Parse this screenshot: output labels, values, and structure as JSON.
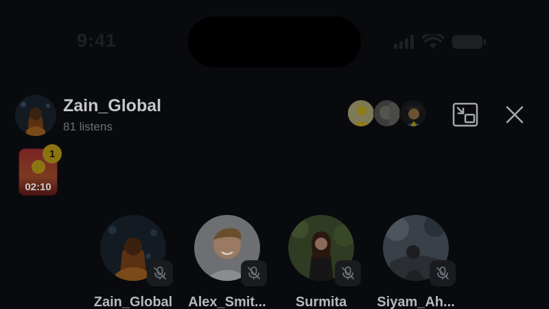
{
  "status_bar": {
    "time": "9:41"
  },
  "room": {
    "host_name": "Zain_Global",
    "listens": "81 listens"
  },
  "gift": {
    "badge_count": "1",
    "timer": "02:10"
  },
  "speakers": [
    {
      "name": "Zain_Global",
      "mic": "mic-off-icon"
    },
    {
      "name": "Alex_Smit...",
      "mic": "mic-off-icon"
    },
    {
      "name": "Surmita",
      "mic": "mic-off-icon"
    },
    {
      "name": "Siyam_Ah...",
      "mic": "mic-off-icon"
    }
  ],
  "colors": {
    "background": "#090a0d",
    "text": "#c4c6cc",
    "muted": "#6d7079",
    "badge": "#8c7412"
  }
}
